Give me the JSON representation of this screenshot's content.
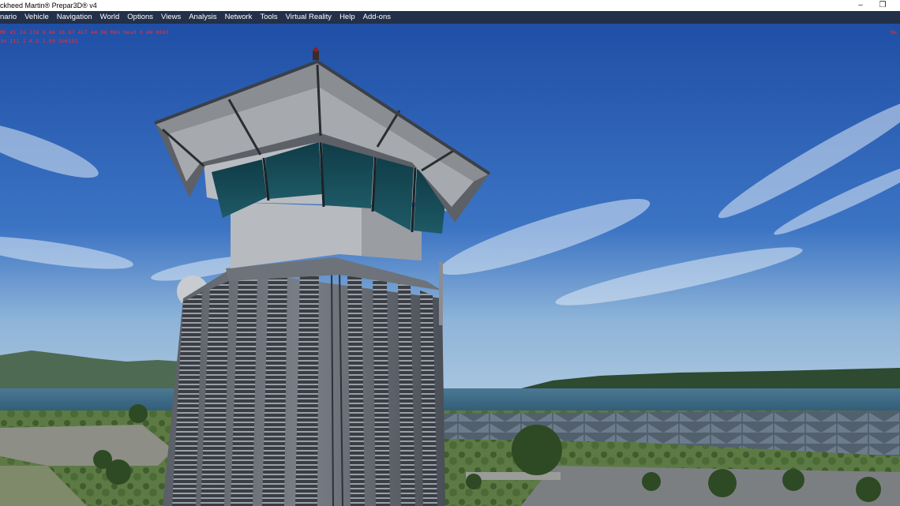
{
  "window": {
    "title": "ckheed Martin® Prepar3D® v4",
    "minimize_glyph": "–",
    "restore_glyph": "❐"
  },
  "menu": [
    {
      "label": "nario"
    },
    {
      "label": "Vehicle"
    },
    {
      "label": "Navigation"
    },
    {
      "label": "World"
    },
    {
      "label": "Options"
    },
    {
      "label": "Views"
    },
    {
      "label": "Analysis"
    },
    {
      "label": "Network"
    },
    {
      "label": "Tools"
    },
    {
      "label": "Virtual Reality"
    },
    {
      "label": "Help"
    },
    {
      "label": "Add-ons"
    }
  ],
  "hud": {
    "line1": "ME 41.24 138 9.96 18.87 ALT 44.98 MAG Head 0 AN 6963",
    "line2": "1m 111 1 A.5 1.69 5e6151",
    "right": "Re",
    "color": "#ff2a2a"
  },
  "scene": {
    "subject": "air-traffic-control-tower",
    "sky_color": "#2b5fb0",
    "horizon_color": "#8eb4d8",
    "water_color": "#35607a"
  }
}
